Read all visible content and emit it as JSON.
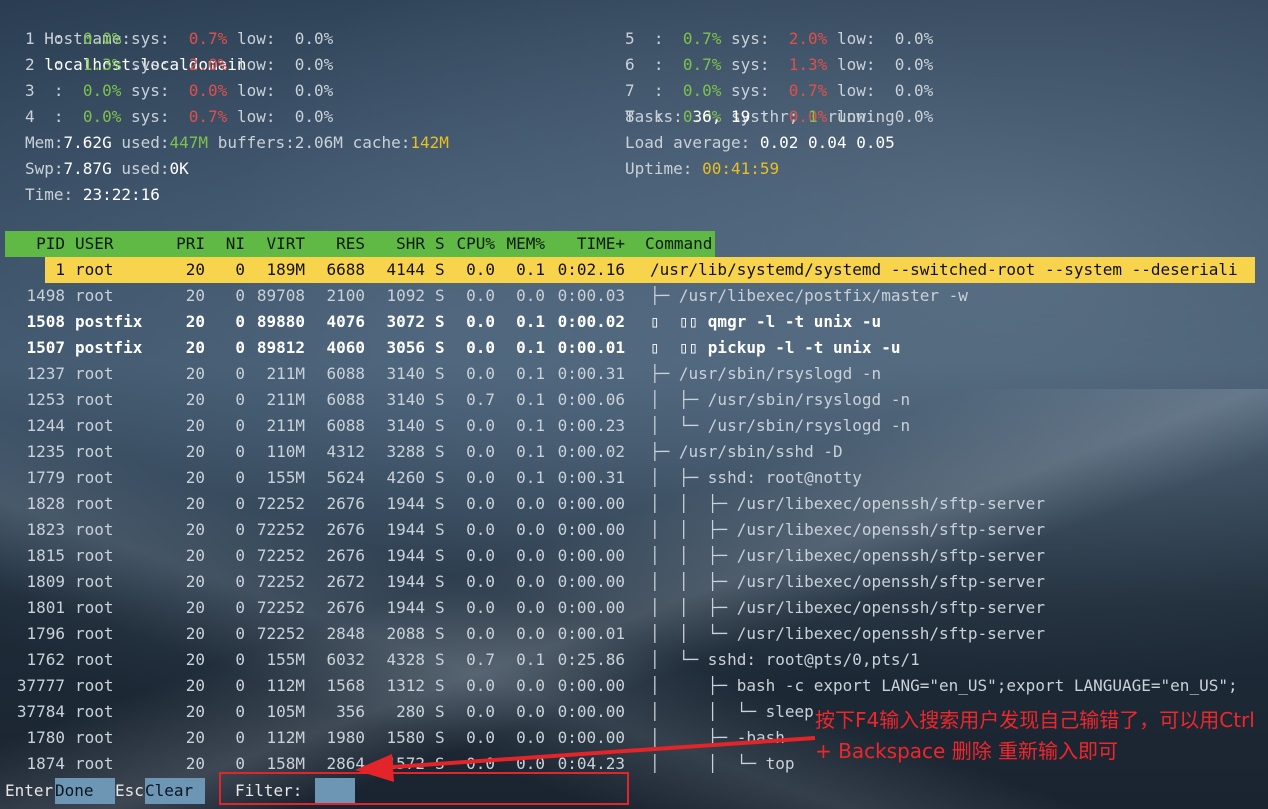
{
  "meters": {
    "hostname_label": "Hostname:",
    "hostname": "localhost.localdomain",
    "cpus": [
      {
        "id": "1",
        "user": "0.0%",
        "sys": "0.7%",
        "low": "0.0%"
      },
      {
        "id": "2",
        "user": "1.3%",
        "sys": "2.0%",
        "low": "0.0%"
      },
      {
        "id": "3",
        "user": "0.0%",
        "sys": "0.0%",
        "low": "0.0%"
      },
      {
        "id": "4",
        "user": "0.0%",
        "sys": "0.7%",
        "low": "0.0%"
      },
      {
        "id": "5",
        "user": "0.7%",
        "sys": "2.0%",
        "low": "0.0%"
      },
      {
        "id": "6",
        "user": "0.7%",
        "sys": "1.3%",
        "low": "0.0%"
      },
      {
        "id": "7",
        "user": "0.0%",
        "sys": "0.7%",
        "low": "0.0%"
      },
      {
        "id": "8",
        "user": "0.0%",
        "sys": "0.0%",
        "low": "0.0%"
      }
    ],
    "sys_label": "sys:",
    "low_label": "low:",
    "mem_label": "Mem:",
    "mem_total": "7.62G",
    "used_label": "used:",
    "mem_used": "447M",
    "buffers_label": "buffers:",
    "mem_buffers": "2.06M",
    "cache_label": "cache:",
    "mem_cache": "142M",
    "swp_label": "Swp:",
    "swp_total": "7.87G",
    "swp_used": "0K",
    "time_label": "Time:",
    "time": "23:22:16",
    "tasks_label": "Tasks:",
    "tasks": "36,",
    "threads": "19",
    "thr_label": "thr;",
    "running": "1",
    "running_label": "running",
    "load_label": "Load average:",
    "load": "0.02 0.04 0.05",
    "uptime_label": "Uptime:",
    "uptime": "00:41:59"
  },
  "header": {
    "pid": "PID",
    "user": "USER",
    "pri": "PRI",
    "ni": "NI",
    "virt": "VIRT",
    "res": "RES",
    "shr": "SHR",
    "s": "S",
    "cpu": "CPU%",
    "mem": "MEM%",
    "time": "TIME+",
    "command": "Command"
  },
  "processes": [
    {
      "pid": "1",
      "user": "root",
      "pri": "20",
      "ni": "0",
      "virt": "189M",
      "res": "6688",
      "shr": "4144",
      "s": "S",
      "cpu": "0.0",
      "mem": "0.1",
      "time": "0:02.16",
      "command": "/usr/lib/systemd/systemd --switched-root --system --deseriali"
    },
    {
      "pid": "1498",
      "user": "root",
      "pri": "20",
      "ni": "0",
      "virt": "89708",
      "res": "2100",
      "shr": "1092",
      "s": "S",
      "cpu": "0.0",
      "mem": "0.0",
      "time": "0:00.03",
      "command": "├─ /usr/libexec/postfix/master -w"
    },
    {
      "pid": "1508",
      "user": "postfix",
      "pri": "20",
      "ni": "0",
      "virt": "89880",
      "res": "4076",
      "shr": "3072",
      "s": "S",
      "cpu": "0.0",
      "mem": "0.1",
      "time": "0:00.02",
      "command": "▯  ▯▯ qmgr -l -t unix -u"
    },
    {
      "pid": "1507",
      "user": "postfix",
      "pri": "20",
      "ni": "0",
      "virt": "89812",
      "res": "4060",
      "shr": "3056",
      "s": "S",
      "cpu": "0.0",
      "mem": "0.1",
      "time": "0:00.01",
      "command": "▯  ▯▯ pickup -l -t unix -u"
    },
    {
      "pid": "1237",
      "user": "root",
      "pri": "20",
      "ni": "0",
      "virt": "211M",
      "res": "6088",
      "shr": "3140",
      "s": "S",
      "cpu": "0.0",
      "mem": "0.1",
      "time": "0:00.31",
      "command": "├─ /usr/sbin/rsyslogd -n"
    },
    {
      "pid": "1253",
      "user": "root",
      "pri": "20",
      "ni": "0",
      "virt": "211M",
      "res": "6088",
      "shr": "3140",
      "s": "S",
      "cpu": "0.7",
      "mem": "0.1",
      "time": "0:00.06",
      "command": "│  ├─ /usr/sbin/rsyslogd -n"
    },
    {
      "pid": "1244",
      "user": "root",
      "pri": "20",
      "ni": "0",
      "virt": "211M",
      "res": "6088",
      "shr": "3140",
      "s": "S",
      "cpu": "0.0",
      "mem": "0.1",
      "time": "0:00.23",
      "command": "│  └─ /usr/sbin/rsyslogd -n"
    },
    {
      "pid": "1235",
      "user": "root",
      "pri": "20",
      "ni": "0",
      "virt": "110M",
      "res": "4312",
      "shr": "3288",
      "s": "S",
      "cpu": "0.0",
      "mem": "0.1",
      "time": "0:00.02",
      "command": "├─ /usr/sbin/sshd -D"
    },
    {
      "pid": "1779",
      "user": "root",
      "pri": "20",
      "ni": "0",
      "virt": "155M",
      "res": "5624",
      "shr": "4260",
      "s": "S",
      "cpu": "0.0",
      "mem": "0.1",
      "time": "0:00.31",
      "command": "│  ├─ sshd: root@notty"
    },
    {
      "pid": "1828",
      "user": "root",
      "pri": "20",
      "ni": "0",
      "virt": "72252",
      "res": "2676",
      "shr": "1944",
      "s": "S",
      "cpu": "0.0",
      "mem": "0.0",
      "time": "0:00.00",
      "command": "│  │  ├─ /usr/libexec/openssh/sftp-server"
    },
    {
      "pid": "1823",
      "user": "root",
      "pri": "20",
      "ni": "0",
      "virt": "72252",
      "res": "2676",
      "shr": "1944",
      "s": "S",
      "cpu": "0.0",
      "mem": "0.0",
      "time": "0:00.00",
      "command": "│  │  ├─ /usr/libexec/openssh/sftp-server"
    },
    {
      "pid": "1815",
      "user": "root",
      "pri": "20",
      "ni": "0",
      "virt": "72252",
      "res": "2676",
      "shr": "1944",
      "s": "S",
      "cpu": "0.0",
      "mem": "0.0",
      "time": "0:00.00",
      "command": "│  │  ├─ /usr/libexec/openssh/sftp-server"
    },
    {
      "pid": "1809",
      "user": "root",
      "pri": "20",
      "ni": "0",
      "virt": "72252",
      "res": "2672",
      "shr": "1944",
      "s": "S",
      "cpu": "0.0",
      "mem": "0.0",
      "time": "0:00.00",
      "command": "│  │  ├─ /usr/libexec/openssh/sftp-server"
    },
    {
      "pid": "1801",
      "user": "root",
      "pri": "20",
      "ni": "0",
      "virt": "72252",
      "res": "2676",
      "shr": "1944",
      "s": "S",
      "cpu": "0.0",
      "mem": "0.0",
      "time": "0:00.00",
      "command": "│  │  ├─ /usr/libexec/openssh/sftp-server"
    },
    {
      "pid": "1796",
      "user": "root",
      "pri": "20",
      "ni": "0",
      "virt": "72252",
      "res": "2848",
      "shr": "2088",
      "s": "S",
      "cpu": "0.0",
      "mem": "0.0",
      "time": "0:00.01",
      "command": "│  │  └─ /usr/libexec/openssh/sftp-server"
    },
    {
      "pid": "1762",
      "user": "root",
      "pri": "20",
      "ni": "0",
      "virt": "155M",
      "res": "6032",
      "shr": "4328",
      "s": "S",
      "cpu": "0.7",
      "mem": "0.1",
      "time": "0:25.86",
      "command": "│  └─ sshd: root@pts/0,pts/1"
    },
    {
      "pid": "37777",
      "user": "root",
      "pri": "20",
      "ni": "0",
      "virt": "112M",
      "res": "1568",
      "shr": "1312",
      "s": "S",
      "cpu": "0.0",
      "mem": "0.0",
      "time": "0:00.00",
      "command": "│     ├─ bash -c export LANG=\"en_US\";export LANGUAGE=\"en_US\";"
    },
    {
      "pid": "37784",
      "user": "root",
      "pri": "20",
      "ni": "0",
      "virt": "105M",
      "res": "356",
      "shr": "280",
      "s": "S",
      "cpu": "0.0",
      "mem": "0.0",
      "time": "0:00.00",
      "command": "│     │  └─ sleep"
    },
    {
      "pid": "1780",
      "user": "root",
      "pri": "20",
      "ni": "0",
      "virt": "112M",
      "res": "1980",
      "shr": "1580",
      "s": "S",
      "cpu": "0.0",
      "mem": "0.0",
      "time": "0:00.00",
      "command": "│     ├─ -bash"
    },
    {
      "pid": "1874",
      "user": "root",
      "pri": "20",
      "ni": "0",
      "virt": "158M",
      "res": "2864",
      "shr": "1572",
      "s": "S",
      "cpu": "0.0",
      "mem": "0.0",
      "time": "0:04.23",
      "command": "│     │  └─ top"
    }
  ],
  "footer": {
    "enter_key": "Enter",
    "done_label": "Done",
    "esc_key": "Esc",
    "clear_label": "Clear",
    "filter_label": "Filter:",
    "filter_value": ""
  },
  "annotation": {
    "text": "按下F4输入搜索用户发现自己输错了，可以用Ctrl + Backspace 删除 重新输入即可"
  },
  "colors": {
    "header_bg": "#5fb944",
    "selected_bg": "#f8d44c",
    "accent_red": "#e3252a"
  }
}
